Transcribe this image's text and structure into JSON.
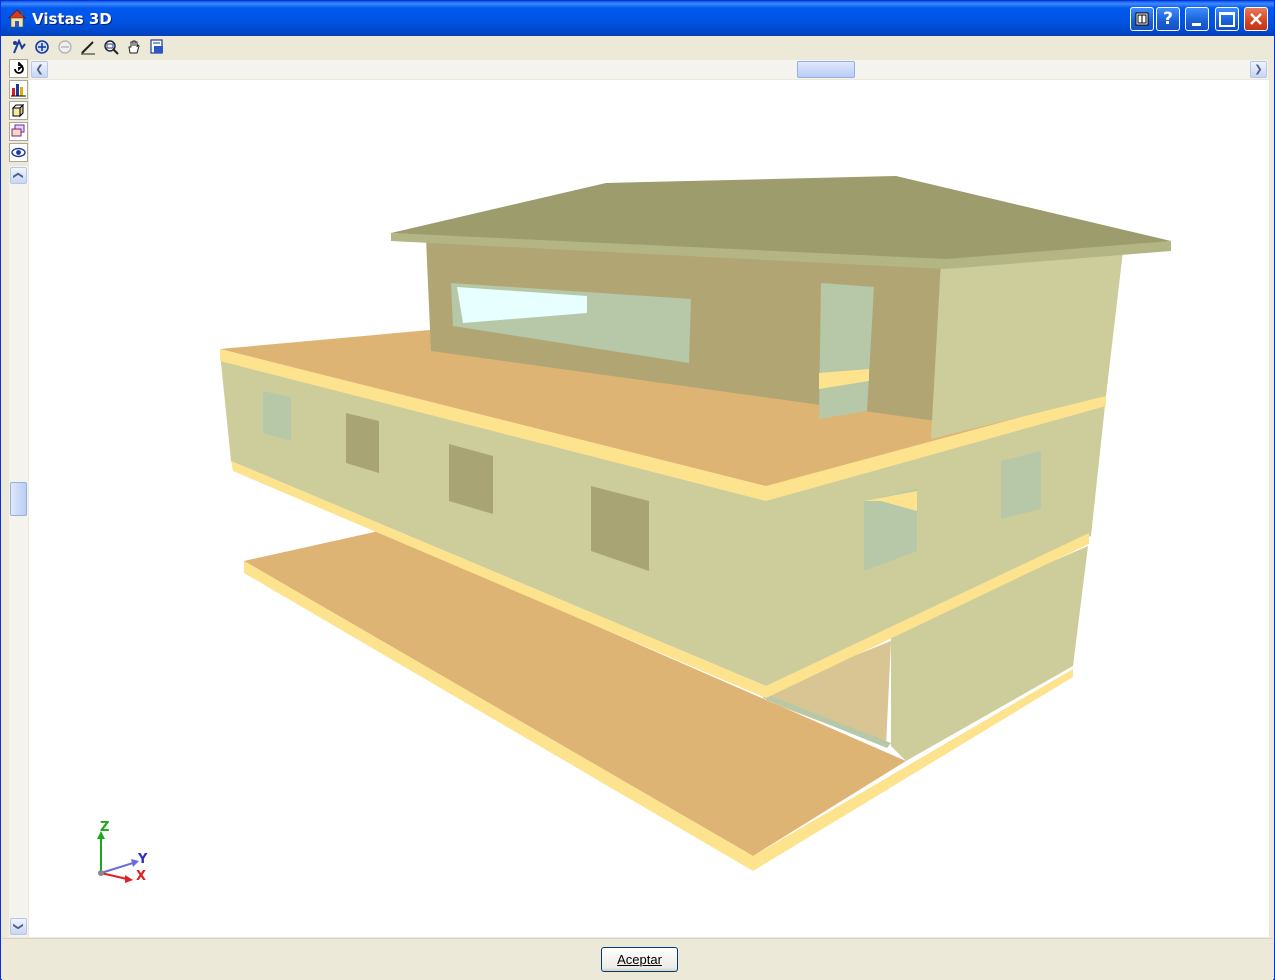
{
  "window": {
    "title": "Vistas 3D"
  },
  "toolbar": {
    "tools": [
      "rotate-tool-icon",
      "zoom-in-icon",
      "zoom-out-icon",
      "pencil-icon",
      "zoom-window-icon",
      "pan-hand-icon",
      "print-preview-icon"
    ]
  },
  "side_tools": [
    "undo-arrow-icon",
    "bar-chart-icon",
    "box-view-icon",
    "layers-icon",
    "visibility-eye-icon"
  ],
  "axes": {
    "z": "Z",
    "y": "Y",
    "x": "X"
  },
  "footer": {
    "accept_label": "Aceptar"
  },
  "colors": {
    "roof": "#9c9c6d",
    "wall": "#cdcd9c",
    "slab_top": "#deb475",
    "slab_edge": "#fde38e",
    "window_glass": "#b6c8a8"
  }
}
